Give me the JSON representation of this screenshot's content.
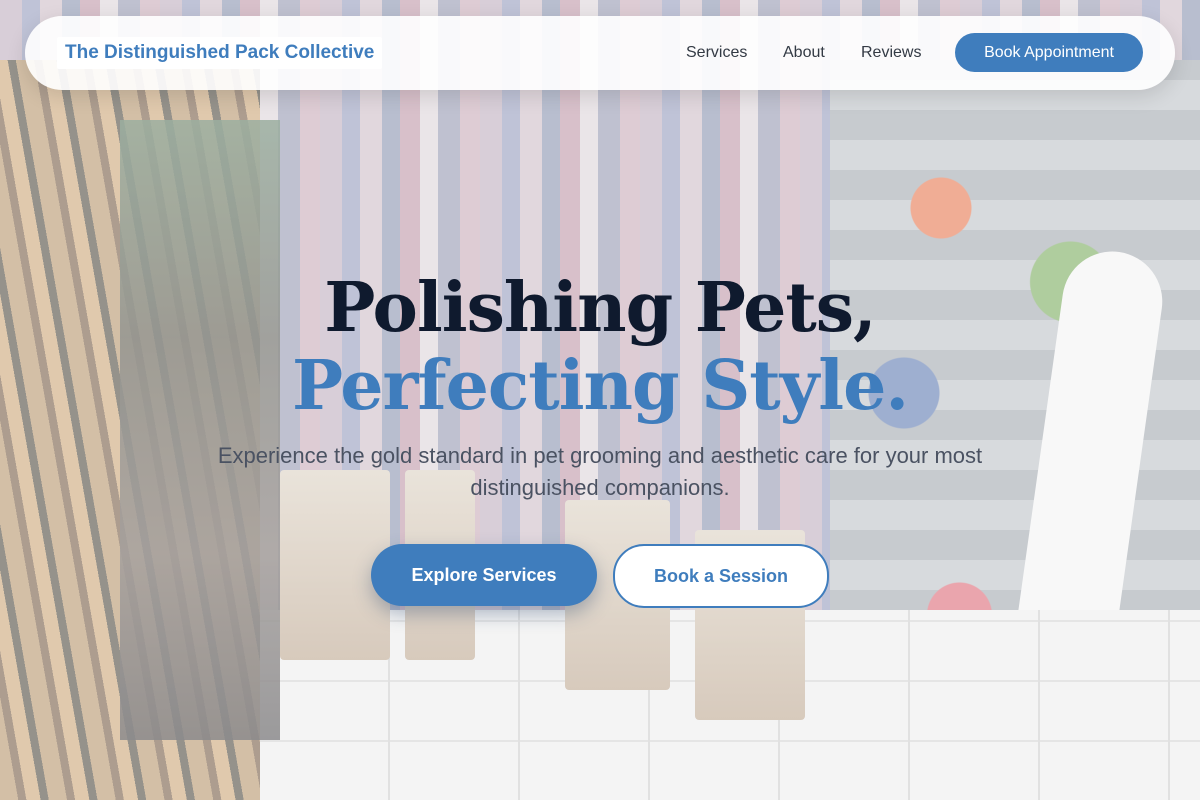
{
  "brand": {
    "name": "The Distinguished Pack Collective"
  },
  "nav": {
    "links": [
      "Services",
      "About",
      "Reviews"
    ],
    "cta": "Book Appointment"
  },
  "hero": {
    "title_line1": "Polishing Pets,",
    "title_line2": "Perfecting Style.",
    "subtitle": "Experience the gold standard in pet grooming and aesthetic care for your most distinguished companions.",
    "primary_button": "Explore Services",
    "secondary_button": "Book a Session"
  },
  "colors": {
    "accent": "#3f7dbd",
    "heading": "#0f1a2e",
    "body_text": "#4a5262"
  }
}
